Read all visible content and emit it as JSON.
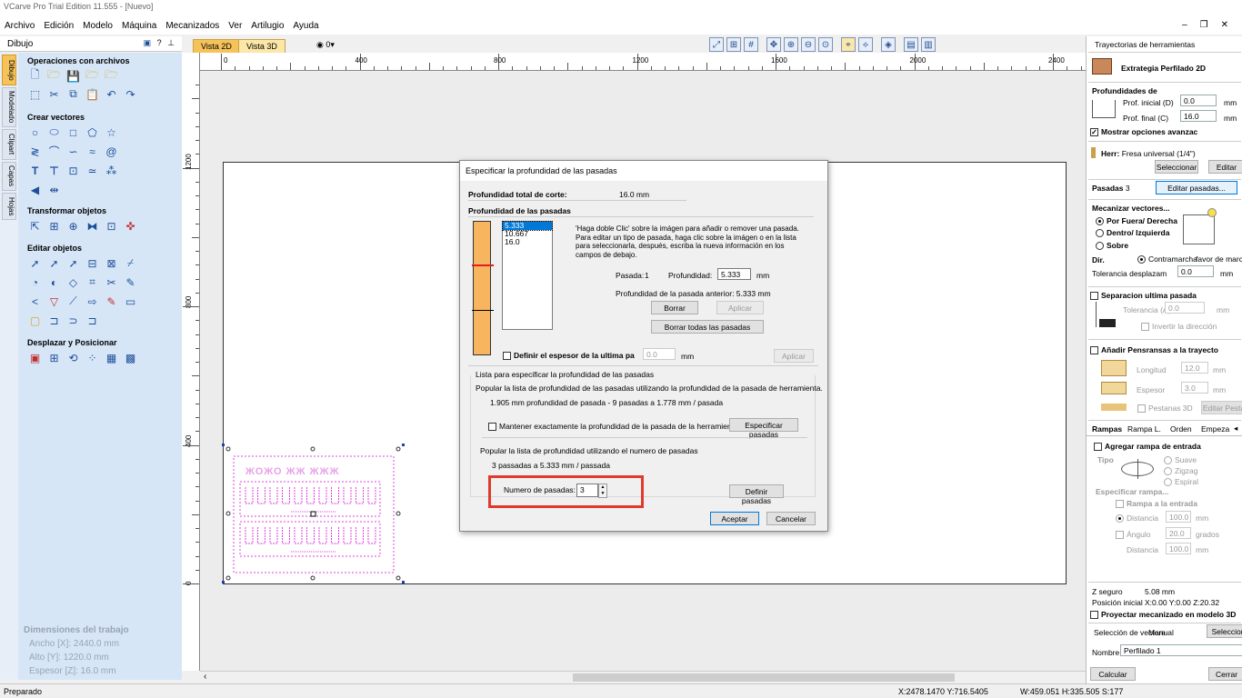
{
  "app": {
    "title": "VCarve Pro Trial Edition 11.555 - [Nuevo]"
  },
  "menu": [
    "Archivo",
    "Edición",
    "Modelo",
    "Máquina",
    "Mecanizados",
    "Ver",
    "Artilugio",
    "Ayuda"
  ],
  "left_panel": {
    "title": "Dibujo",
    "vtabs": [
      "Dibujo",
      "Modelado",
      "Clipart",
      "Capas",
      "Hojas"
    ],
    "sections": {
      "file_ops": "Operaciones con archivos",
      "create_vectors": "Crear vectores",
      "transform": "Transformar objetos",
      "edit": "Editar objetos",
      "move": "Desplazar y Posicionar"
    },
    "job": {
      "heading": "Dimensiones del trabajo",
      "width": "Ancho   [X]: 2440.0 mm",
      "height": "Alto    [Y]: 1220.0 mm",
      "thickness": "Espesor [Z]: 16.0 mm"
    }
  },
  "view_tabs": {
    "tab_2d": "Vista 2D",
    "tab_3d": "Vista 3D",
    "layer_count": "0"
  },
  "rulers": {
    "h_labels": [
      "0",
      "400",
      "800",
      "1200",
      "1600",
      "2000",
      "2400"
    ],
    "v_labels": [
      "1200",
      "800",
      "400",
      "0"
    ]
  },
  "dialog": {
    "title": "Especificar la profundidad de las pasadas",
    "total_label": "Profundidad total de corte:",
    "total_value": "16.0 mm",
    "passes_heading": "Profundidad de las pasadas",
    "pass_list": [
      "5.333",
      "10.667",
      "16.0"
    ],
    "help_text": [
      "'Haga doble Clic' sobre la imágen para añadir o remover una pasada.",
      "Para editar un tipo de pasada, haga clic sobre la imágen o en la lista",
      "para seleccionarla, después, escriba la nueva información en los",
      "campos de debajo."
    ],
    "pass_label": "Pasada:",
    "pass_number": "1",
    "depth_label": "Profundidad:",
    "depth_value": "5.333",
    "unit": "mm",
    "prev_depth": "Profundidad de la pasada anterior:  5.333 mm",
    "delete_btn": "Borrar",
    "apply_btn": "Aplicar",
    "delete_all_btn": "Borrar todas las pasadas",
    "last_thickness_label": "Definir el espesor de la ultima pa",
    "last_thickness_value": "0.0",
    "list_group": "Lista para especificar la profundidad de las pasadas",
    "populate_tool_text": "Popular la lista de profundidad de las pasadas utilizando la profundidad de la pasada de herramienta.",
    "tool_summary": "1.905 mm profundidad de pasada - 9 pasadas a 1.778 mm / pasada",
    "keep_exact_label": "Mantener exactamente la profundidad de la pasada de la herramienta",
    "specify_btn": "Especificar pasadas",
    "populate_count_text": "Popular la lista de profundidad utilizando el numero de pasadas",
    "count_summary": "3 passadas a 5.333 mm / passada",
    "num_label": "Numero de pasadas:",
    "num_value": "3",
    "define_btn": "Definir pasadas",
    "ok_btn": "Aceptar",
    "cancel_btn": "Cancelar"
  },
  "right_panel": {
    "header": "Trayectorias de herramientas",
    "strategy": "Extrategia Perfilado 2D",
    "depths_heading": "Profundidades de",
    "start_depth_label": "Prof. inicial (D)",
    "start_depth": "0.0",
    "end_depth_label": "Prof. final (C)",
    "end_depth": "16.0",
    "mm": "mm",
    "show_advanced": "Mostrar opciones avanzac",
    "tool_label": "Herr:",
    "tool_name": "Fresa universal (1/4\")",
    "select_btn": "Seleccionar",
    "edit_btn": "Editar",
    "passes_label": "Pasadas",
    "passes_count": "3",
    "edit_passes_btn": "Editar pasadas...",
    "machine_vectors": "Mecanizar vectores...",
    "outside": "Por Fuera/ Derecha",
    "inside": "Dentro/ Izquierda",
    "on": "Sobre",
    "dir_label": "Dir.",
    "climb": "Contramarcha",
    "conventional": "favor de march",
    "tolerance_label": "Tolerancia desplazam",
    "tolerance": "0.0",
    "last_sep": "Separacion ultima pasada",
    "allowance_label": "Tolerancia (A)",
    "allowance": "0.0",
    "reverse_dir": "Invertir la dirección",
    "tabs_heading": "Añadir Pensransas a la trayecto",
    "length_label": "Longitud",
    "length": "12.0",
    "thickness_label": "Espesor",
    "thickness": "3.0",
    "tabs3d": "Pestanas 3D",
    "edit_tabs_btn": "Editar Pesta",
    "tabs": [
      "Rampas",
      "Rampa L.",
      "Orden",
      "Empeza"
    ],
    "add_ramp": "Agregar rampa de entrada",
    "type_label": "Tipo",
    "smooth": "Suave",
    "zigzag": "Zigzag",
    "spiral": "Espiral",
    "specify_ramp": "Especificar rampa...",
    "ramp_in": "Rampa a la entrada",
    "distance_label": "Distancia",
    "distance": "100.0",
    "angle_label": "Ángulo",
    "angle": "20.0",
    "degrees": "grados",
    "distance2": "100.0",
    "zsafe_label": "Z seguro",
    "zsafe": "5.08 mm",
    "home_label": "Posición inicial",
    "home": "X:0.00 Y:0.00 Z:20.32",
    "project3d": "Proyectar mecanizado en modelo 3D",
    "vector_sel_label": "Selección de vectore",
    "vector_sel_mode": "Manual",
    "vector_sel_btn": "Seleccion",
    "name_label": "Nombre:",
    "name": "Perfilado 1",
    "calc_btn": "Calcular",
    "close_btn": "Cerrar"
  },
  "status": {
    "left": "Preparado",
    "coords": "X:2478.1470 Y:716.5405",
    "size": "W:459.051   H:335.505  S:177"
  }
}
